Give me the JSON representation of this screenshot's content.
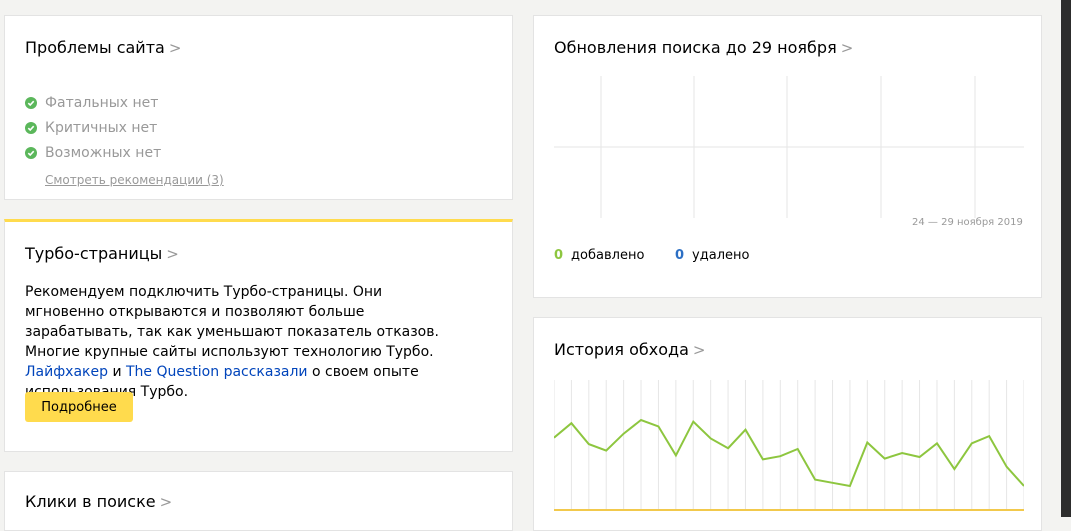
{
  "problems": {
    "title": "Проблемы сайта",
    "chevron": ">",
    "items": [
      {
        "label": "Фатальных нет"
      },
      {
        "label": "Критичных нет"
      },
      {
        "label": "Возможных нет"
      }
    ],
    "recommendations_link": "Смотреть рекомендации (3)",
    "status_color": "#5bb75b"
  },
  "turbo": {
    "title": "Турбо-страницы",
    "chevron": ">",
    "text_1": "Рекомендуем подключить Турбо-страницы. Они мгновенно открываются и позволяют больше зарабатывать, так как уменьшают показатель отказов. Многие крупные сайты используют технологию Турбо. ",
    "link_1": "Лайфхакер",
    "text_2": " и ",
    "link_2": "The Question",
    "link_3": "рассказали",
    "text_3": " о своем опыте использования Турбо.",
    "button_label": "Подробнее",
    "accent_color": "#ffdb4d"
  },
  "clicks": {
    "title": "Клики в поиске",
    "chevron": ">"
  },
  "search_updates": {
    "title": "Обновления поиска до 29 ноября",
    "chevron": ">",
    "range_label": "24 — 29 ноября 2019",
    "added_value": "0",
    "added_label": "добавлено",
    "removed_value": "0",
    "removed_label": "удалено",
    "added_color": "#8dc63f",
    "removed_color": "#2c6fc4"
  },
  "crawl_history": {
    "title": "История обхода",
    "chevron": ">",
    "line_color": "#8dc63f",
    "baseline_color": "#f2c94c"
  },
  "chart_data": {
    "type": "line",
    "series": [
      {
        "values": [
          60,
          78,
          52,
          44,
          65,
          82,
          74,
          38,
          80,
          59,
          47,
          70,
          33,
          37,
          46,
          8,
          4,
          0,
          54,
          34,
          41,
          36,
          53,
          21,
          53,
          62,
          24,
          0
        ]
      }
    ]
  }
}
